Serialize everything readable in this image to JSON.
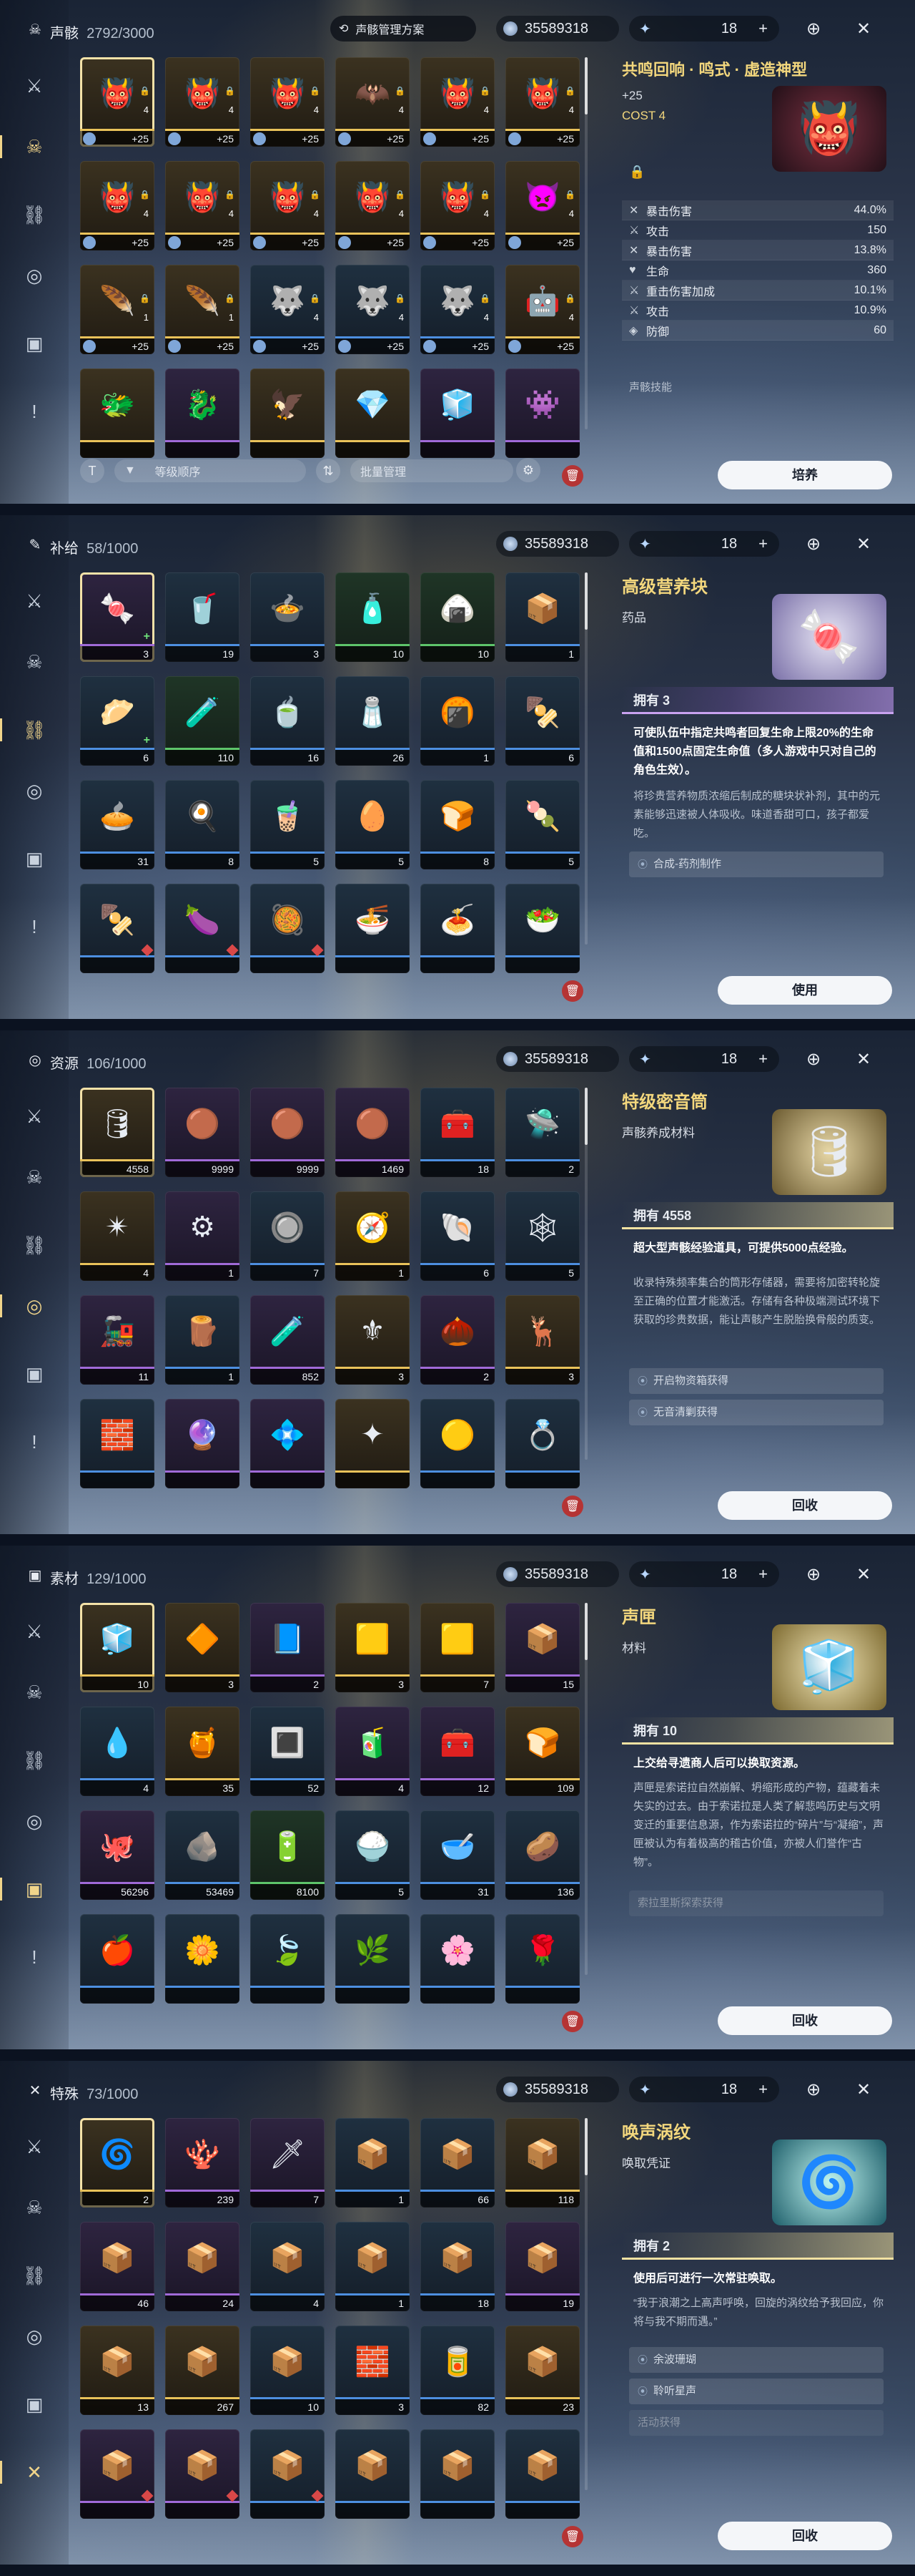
{
  "common": {
    "coins": "35589318",
    "level": "18",
    "plus": "+",
    "sidebar_icons": [
      "sword-icon",
      "mask-icon",
      "chain-icon",
      "resource-icon",
      "material-icon",
      "special-icon"
    ]
  },
  "echo": {
    "cat_name": "声骸",
    "cat_count": "2792/3000",
    "plan_label": "声骸管理方案",
    "title": "共鸣回响 · 鸣式 · 虚造神型",
    "level_plus": "+25",
    "cost": "COST  4",
    "stats": [
      {
        "name": "暴击伤害",
        "value": "44.0%"
      },
      {
        "name": "攻击",
        "value": "150"
      },
      {
        "name": "暴击伤害",
        "value": "13.8%"
      },
      {
        "name": "生命",
        "value": "360"
      },
      {
        "name": "重击伤害加成",
        "value": "10.1%"
      },
      {
        "name": "攻击",
        "value": "10.9%"
      },
      {
        "name": "防御",
        "value": "60"
      }
    ],
    "skill_label": "声骸技能",
    "sort_label": "等级顺序",
    "bulk_label": "批量管理",
    "action": "培养",
    "cells": [
      {
        "bot": "+25",
        "lv": "4"
      },
      {
        "bot": "+25",
        "lv": "4"
      },
      {
        "bot": "+25",
        "lv": "4"
      },
      {
        "bot": "+25",
        "lv": "4"
      },
      {
        "bot": "+25",
        "lv": "4"
      },
      {
        "bot": "+25",
        "lv": "4"
      },
      {
        "bot": "+25",
        "lv": "4"
      },
      {
        "bot": "+25",
        "lv": "4"
      },
      {
        "bot": "+25",
        "lv": "4"
      },
      {
        "bot": "+25",
        "lv": "4"
      },
      {
        "bot": "+25",
        "lv": "4"
      },
      {
        "bot": "+25",
        "lv": "4"
      },
      {
        "bot": "+25",
        "lv": "1"
      },
      {
        "bot": "+25",
        "lv": "1"
      },
      {
        "bot": "+25",
        "lv": "4"
      },
      {
        "bot": "+25",
        "lv": "4"
      },
      {
        "bot": "+25",
        "lv": "4"
      },
      {
        "bot": "+25",
        "lv": "4"
      },
      {
        "bot": "",
        "lv": ""
      },
      {
        "bot": "",
        "lv": ""
      },
      {
        "bot": "",
        "lv": ""
      },
      {
        "bot": "",
        "lv": ""
      },
      {
        "bot": "",
        "lv": ""
      },
      {
        "bot": "",
        "lv": ""
      }
    ]
  },
  "supply": {
    "cat_name": "补给",
    "cat_count": "58/1000",
    "title": "高级营养块",
    "subtitle": "药品",
    "owned": "拥有 3",
    "desc_main": "可使队伍中指定共鸣者回复生命上限20%的生命值和1500点固定生命值（多人游戏中只对自己的角色生效）。",
    "desc_flavor": "将珍贵营养物质浓缩后制成的糖块状补剂，其中的元素能够迅速被人体吸收。味道香甜可口，孩子都爱吃。",
    "source": "合成-药剂制作",
    "action": "使用",
    "cells": [
      "3",
      "19",
      "3",
      "10",
      "10",
      "1",
      "6",
      "110",
      "16",
      "26",
      "1",
      "6",
      "31",
      "8",
      "5",
      "5",
      "8",
      "5",
      "",
      "",
      "",
      "",
      "",
      ""
    ]
  },
  "resource": {
    "cat_name": "资源",
    "cat_count": "106/1000",
    "title": "特级密音筒",
    "subtitle": "声骸养成材料",
    "owned": "拥有 4558",
    "desc_main": "超大型声骸经验道具，可提供5000点经验。",
    "desc_flavor": "收录特殊频率集合的筒形存储器，需要将加密转轮旋至正确的位置才能激活。存储有各种极端测试环境下获取的珍贵数据，能让声骸产生脱胎换骨般的质变。",
    "sources": [
      "开启物资箱获得",
      "无音清剿获得"
    ],
    "action": "回收",
    "cells": [
      "4558",
      "9999",
      "9999",
      "1469",
      "18",
      "2",
      "4",
      "1",
      "7",
      "1",
      "6",
      "5",
      "11",
      "1",
      "852",
      "3",
      "2",
      "3",
      "",
      "",
      "",
      "",
      "",
      ""
    ]
  },
  "material": {
    "cat_name": "素材",
    "cat_count": "129/1000",
    "title": "声匣",
    "subtitle": "材料",
    "owned": "拥有 10",
    "desc_main": "上交给寻遗商人后可以换取资源。",
    "desc_flavor": "声匣是索诺拉自然崩解、坍缩形成的产物，蕴藏着未失实的过去。由于索诺拉是人类了解悲鸣历史与文明变迁的重要信息源，作为索诺拉的“碎片”与“凝缩”，声匣被认为有着极高的稽古价值，亦被人们誉作“古物”。",
    "source": "索拉里斯探索获得",
    "action": "回收",
    "cells": [
      "10",
      "3",
      "2",
      "3",
      "7",
      "15",
      "4",
      "35",
      "52",
      "4",
      "12",
      "109",
      "56296",
      "53469",
      "8100",
      "5",
      "31",
      "136",
      "",
      "",
      "",
      "",
      "",
      ""
    ]
  },
  "special": {
    "cat_name": "特殊",
    "cat_count": "73/1000",
    "title": "唤声涡纹",
    "subtitle": "唤取凭证",
    "owned": "拥有 2",
    "desc_main": "使用后可进行一次常驻唤取。",
    "desc_flavor": "“我于浪潮之上高声呼唤，回旋的涡纹给予我回应，你将与我不期而遇。”",
    "sources": [
      "余波珊瑚",
      "聆听星声"
    ],
    "source_dim": "活动获得",
    "action": "回收",
    "cells": [
      "2",
      "239",
      "7",
      "1",
      "66",
      "118",
      "46",
      "24",
      "4",
      "1",
      "18",
      "19",
      "13",
      "267",
      "10",
      "3",
      "82",
      "23",
      "",
      "",
      "",
      "",
      "",
      ""
    ]
  }
}
